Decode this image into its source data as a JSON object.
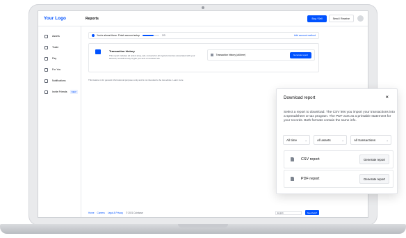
{
  "header": {
    "logo": "Your Logo",
    "page_title": "Reports",
    "buy_sell_label": "Buy / Sell",
    "send_receive_label": "Send / Receive"
  },
  "sidebar": {
    "items": [
      {
        "label": "Assets",
        "icon": "assets-icon"
      },
      {
        "label": "Trade",
        "icon": "trade-icon"
      },
      {
        "label": "Pay",
        "icon": "pay-icon"
      },
      {
        "label": "For You",
        "icon": "for-you-icon"
      },
      {
        "label": "Notifications",
        "icon": "bell-icon"
      },
      {
        "label": "Invite Friends",
        "icon": "gift-icon",
        "badge": "NEW"
      }
    ]
  },
  "progress": {
    "text": "You're almost there. Finish account setup",
    "count": "2/3",
    "fraction": 0.67,
    "link": "Add account method"
  },
  "transaction_card": {
    "title": "Transaction history",
    "description": "This report includes all orders (buy, sell, convert) for all cryptocurrencies associated with your account, as well as any crypto you sent or received via",
    "row_label": "Transaction history (all-time)",
    "generate_label": "Generate report"
  },
  "disclaimer": "This feature is for general informational purposes only and is not intended to be tax advice. Learn more",
  "footer": {
    "links": [
      "Home",
      "Careers",
      "Legal & Privacy",
      "© 2021 Coinbase"
    ],
    "language": "English",
    "need_help": "Need help?"
  },
  "modal": {
    "title": "Download report",
    "close_glyph": "×",
    "description": "Select a report to download. The CSV lets you import your transactions into a spreadsheet or tax program. The PDF acts as a printable statement for your records. Both formats contain the same info.",
    "filters": [
      "All time",
      "All assets",
      "All transactions"
    ],
    "chevron": "⌄",
    "reports": [
      {
        "label": "CSV report",
        "button": "Generate report"
      },
      {
        "label": "PDF report",
        "button": "Generate report"
      }
    ]
  },
  "colors": {
    "accent": "#0052ff"
  }
}
